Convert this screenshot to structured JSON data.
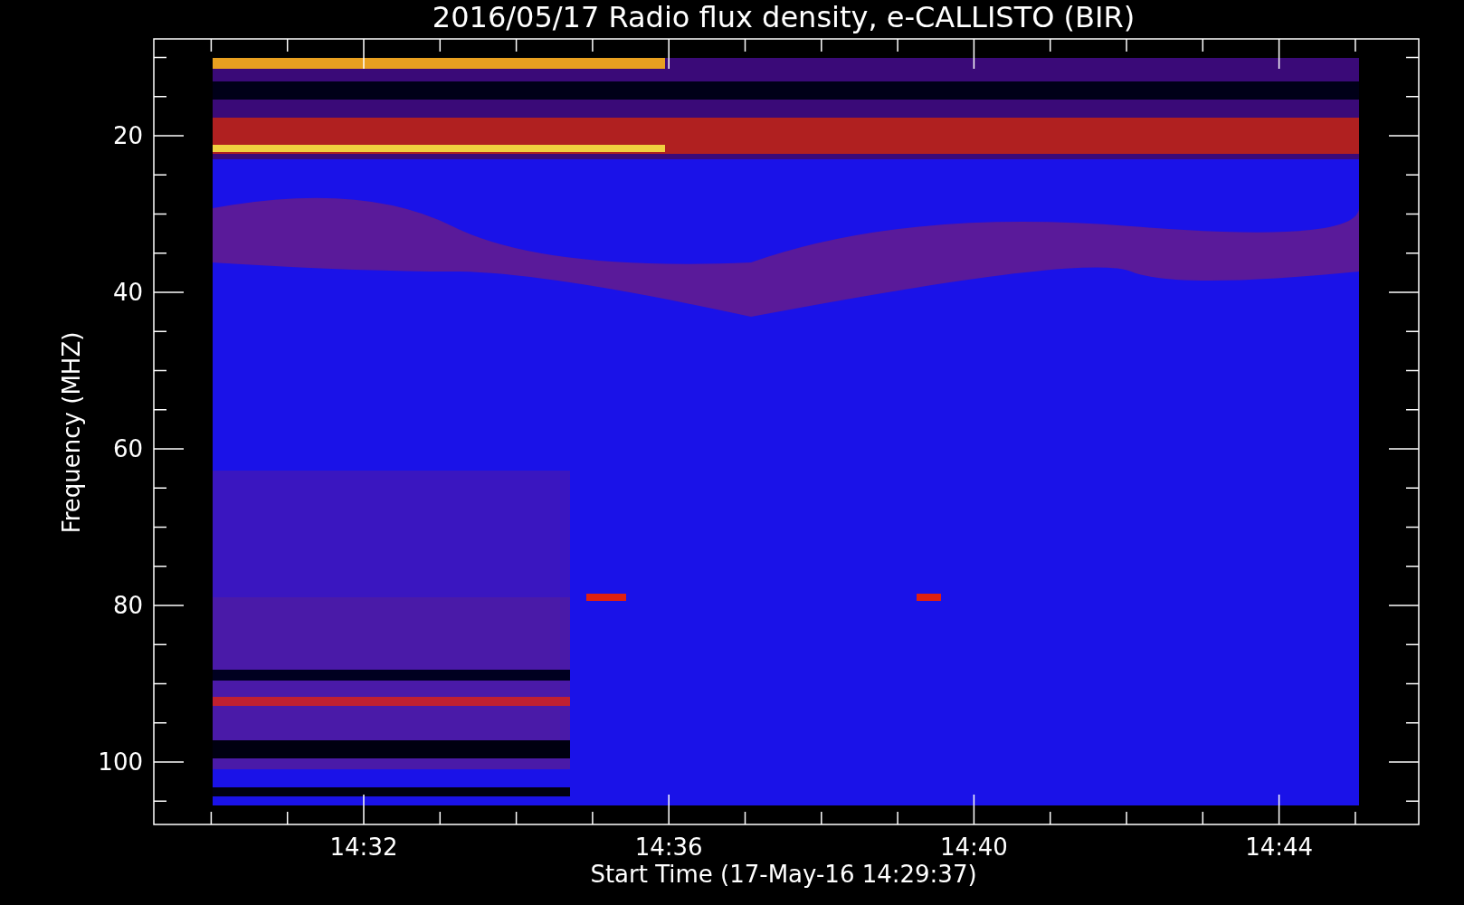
{
  "title": "2016/05/17  Radio flux density, e-CALLISTO (BIR)",
  "y_axis": {
    "label": "Frequency (MHZ)",
    "ticks": [
      "20",
      "40",
      "60",
      "80",
      "100"
    ]
  },
  "x_axis": {
    "label": "Start Time (17-May-16 14:29:37)",
    "ticks": [
      "14:32",
      "14:36",
      "14:40",
      "14:44"
    ]
  }
}
